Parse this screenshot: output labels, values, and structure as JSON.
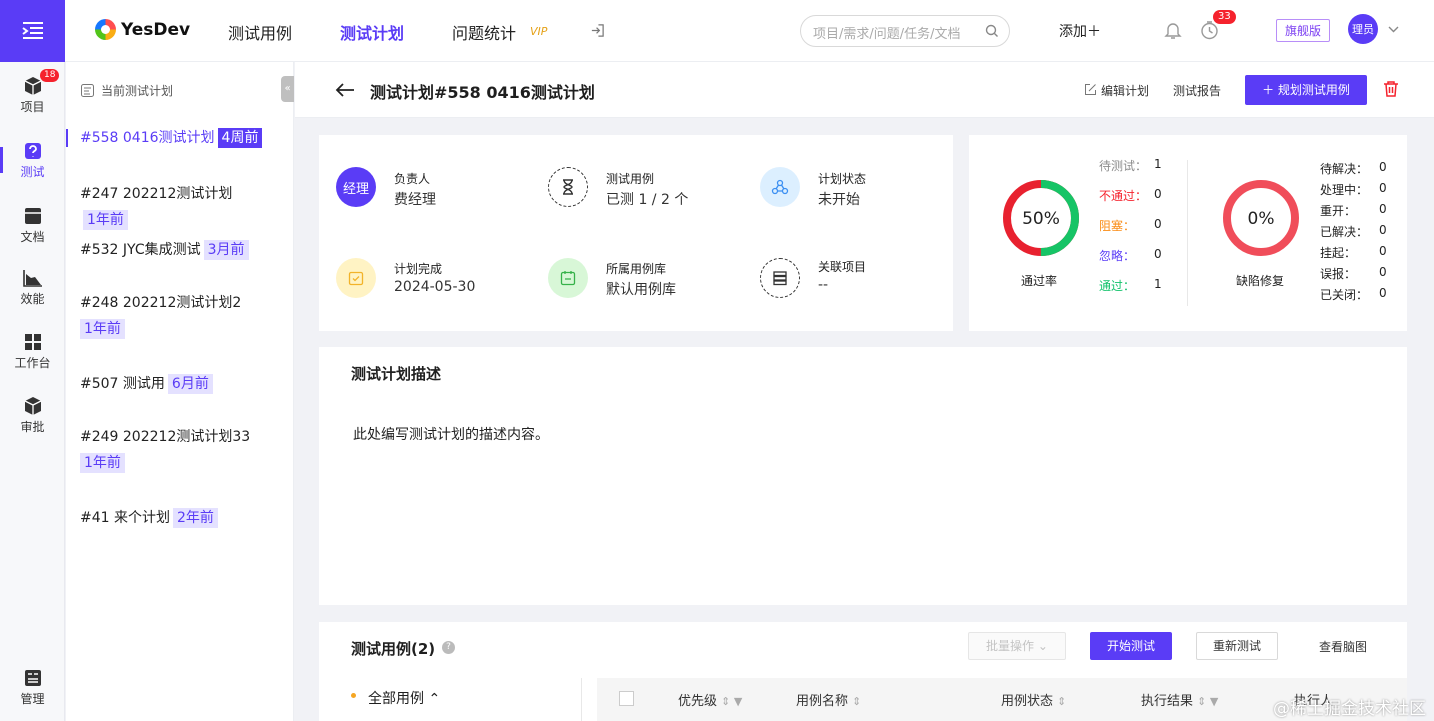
{
  "rail": {
    "items": [
      {
        "label": "项目",
        "icon": "cube-icon",
        "badge": "18"
      },
      {
        "label": "测试",
        "icon": "test-doc-icon",
        "active": true
      },
      {
        "label": "文档",
        "icon": "document-icon"
      },
      {
        "label": "效能",
        "icon": "chart-area-icon"
      },
      {
        "label": "工作台",
        "icon": "grid-icon"
      },
      {
        "label": "审批",
        "icon": "cube-check-icon"
      }
    ],
    "bottom_label": "管理"
  },
  "topbar": {
    "brand": "YesDev",
    "nav": [
      "测试用例",
      "测试计划",
      "问题统计"
    ],
    "vip": "VIP",
    "search_placeholder": "项目/需求/问题/任务/文档",
    "add_label": "添加＋",
    "timer_badge": "33",
    "edition": "旗舰版",
    "avatar": "理员"
  },
  "sidebar": {
    "header": "当前测试计划",
    "plans": [
      {
        "name": "#558 0416测试计划",
        "age": "4周前",
        "active": true
      },
      {
        "name": "#247 202212测试计划",
        "age": "1年前"
      },
      {
        "name": "#532 JYC集成测试",
        "age": "3月前"
      },
      {
        "name": "#248 202212测试计划2",
        "age": "1年前"
      },
      {
        "name": "#507 测试用",
        "age": "6月前"
      },
      {
        "name": "#249 202212测试计划33",
        "age": "1年前"
      },
      {
        "name": "#41 来个计划",
        "age": "2年前"
      }
    ]
  },
  "header": {
    "title": "测试计划#558 0416测试计划",
    "edit": "编辑计划",
    "report": "测试报告",
    "plan_cases": "＋ 规划测试用例"
  },
  "info": {
    "owner_avatar": "经理",
    "owner_label": "负责人",
    "owner_value": "费经理",
    "cases_label": "测试用例",
    "cases_value": "已测 1 / 2 个",
    "status_label": "计划状态",
    "status_value": "未开始",
    "done_label": "计划完成",
    "done_value": "2024-05-30",
    "lib_label": "所属用例库",
    "lib_value": "默认用例库",
    "project_label": "关联项目",
    "project_value": "--"
  },
  "pass_ring": {
    "percent": 50,
    "percent_text": "50%",
    "label": "通过率",
    "stats": [
      {
        "k": "待测试：",
        "v": "1",
        "color": "#8c8c8c"
      },
      {
        "k": "不通过：",
        "v": "0",
        "color": "#f5222d"
      },
      {
        "k": "阻塞：",
        "v": "0",
        "color": "#fa8c16"
      },
      {
        "k": "忽略：",
        "v": "0",
        "color": "#5a3cf6"
      },
      {
        "k": "通过：",
        "v": "1",
        "color": "#13c26b"
      }
    ]
  },
  "defect_ring": {
    "percent": 0,
    "percent_text": "0%",
    "label": "缺陷修复",
    "stats": [
      {
        "k": "待解决：",
        "v": "0"
      },
      {
        "k": "处理中：",
        "v": "0"
      },
      {
        "k": "重开：",
        "v": "0"
      },
      {
        "k": "已解决：",
        "v": "0"
      },
      {
        "k": "挂起：",
        "v": "0"
      },
      {
        "k": "误报：",
        "v": "0"
      },
      {
        "k": "已关闭：",
        "v": "0"
      }
    ]
  },
  "description": {
    "title": "测试计划描述",
    "text": "此处编写测试计划的描述内容。"
  },
  "cases": {
    "title": "测试用例(2)",
    "batch": "批量操作",
    "start": "开始测试",
    "retest": "重新测试",
    "mindmap": "查看脑图",
    "tree_all": "全部用例",
    "columns": [
      "优先级",
      "用例名称",
      "用例状态",
      "执行结果",
      "执行人"
    ]
  },
  "watermark": "@稀土掘金技术社区"
}
